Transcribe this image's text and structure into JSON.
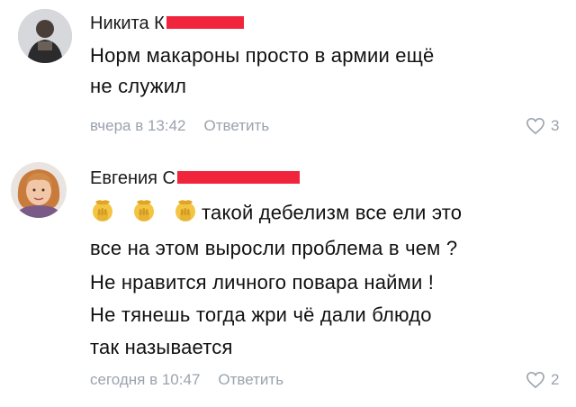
{
  "colors": {
    "meta_gray": "#9aa3ad",
    "redaction_red": "#f0243a",
    "text": "#111111"
  },
  "comments": [
    {
      "author": "Никита К",
      "lines": [
        "Норм макароны просто в армии ещё",
        "не служил"
      ],
      "time": "вчера в 13:42",
      "reply_label": "Ответить",
      "likes": "3",
      "avatar_icon": "profile-photo"
    },
    {
      "author": "Евгения С",
      "lines": [
        "такой дебелизм все ели это",
        "все на этом выросли проблема в чем ?",
        "Не нравится личного повара найми !",
        "Не тянешь тогда жри чё дали блюдо",
        "так называется"
      ],
      "time": "сегодня в 10:47",
      "reply_label": "Ответить",
      "likes": "2",
      "avatar_icon": "profile-photo",
      "emojis": [
        "facepalm-emoji",
        "facepalm-emoji",
        "facepalm-emoji"
      ]
    }
  ]
}
